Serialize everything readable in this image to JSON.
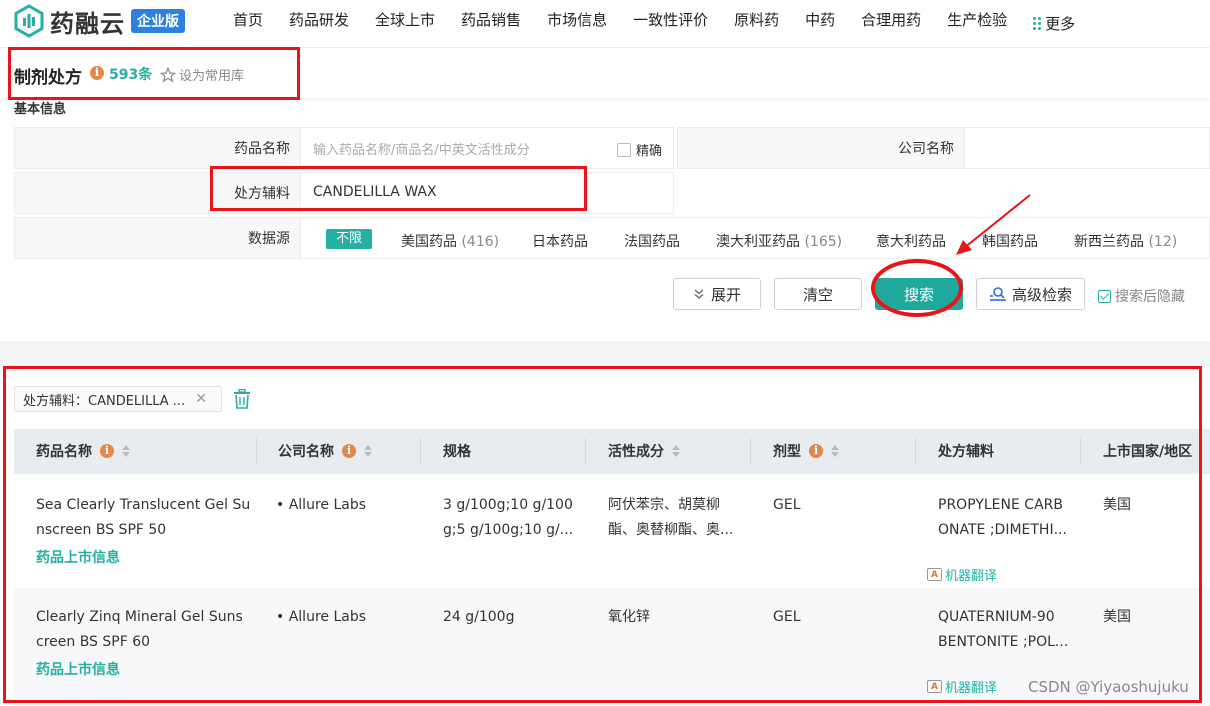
{
  "brand": {
    "name": "药融云",
    "edition": "企业版",
    "accent": "#25b0a3"
  },
  "nav": {
    "items": [
      "首页",
      "药品研发",
      "全球上市",
      "药品销售",
      "市场信息",
      "一致性评价",
      "原料药",
      "中药",
      "合理用药",
      "生产检验"
    ],
    "active": "药品研发",
    "more_label": "更多"
  },
  "header": {
    "title": "制剂处方",
    "count": "593条",
    "favorite_label": "设为常用库",
    "section_label": "基本信息"
  },
  "form": {
    "drug_name_label": "药品名称",
    "drug_name_placeholder": "输入药品名称/商品名/中英文活性成分",
    "exact_label": "精确",
    "company_label": "公司名称",
    "excipient_label": "处方辅料",
    "excipient_value": "CANDELILLA WAX",
    "source_label": "数据源",
    "source_all": "不限",
    "sources": [
      {
        "name": "美国药品",
        "count": "(416)"
      },
      {
        "name": "日本药品",
        "count": ""
      },
      {
        "name": "法国药品",
        "count": ""
      },
      {
        "name": "澳大利亚药品",
        "count": "(165)"
      },
      {
        "name": "意大利药品",
        "count": ""
      },
      {
        "name": "韩国药品",
        "count": ""
      },
      {
        "name": "新西兰药品",
        "count": "(12)"
      }
    ]
  },
  "buttons": {
    "expand": "展开",
    "clear": "清空",
    "search": "搜索",
    "advanced": "高级检索",
    "hide_after_search": "搜索后隐藏"
  },
  "results": {
    "filter_chip": "处方辅料：CANDELILLA ...",
    "columns": [
      "药品名称",
      "公司名称",
      "规格",
      "活性成分",
      "剂型",
      "处方辅料",
      "上市国家/地区"
    ],
    "rows": [
      {
        "name_line1": "Sea Clearly Translucent Gel Su",
        "name_line2": "nscreen BS SPF 50",
        "link": "药品上市信息",
        "company": "• Allure Labs",
        "spec_line1": "3 g/100g;10 g/100",
        "spec_line2": "g;5 g/100g;10 g/...",
        "active_line1": "阿伏苯宗、胡莫柳",
        "active_line2": "酯、奥替柳酯、奥...",
        "form": "GEL",
        "excipient_line1": "PROPYLENE CARB",
        "excipient_line2": "ONATE ;DIMETHI...",
        "translate": "机器翻译",
        "country": "美国"
      },
      {
        "name_line1": "Clearly Zinq Mineral Gel Suns",
        "name_line2": "creen BS SPF 60",
        "link": "药品上市信息",
        "company": "• Allure Labs",
        "spec_line1": "24 g/100g",
        "spec_line2": "",
        "active_line1": "氧化锌",
        "active_line2": "",
        "form": "GEL",
        "excipient_line1": "QUATERNIUM-90",
        "excipient_line2": "BENTONITE ;POL...",
        "translate": "机器翻译",
        "country": "美国"
      }
    ]
  },
  "watermark": "CSDN @Yiyaoshujuku"
}
